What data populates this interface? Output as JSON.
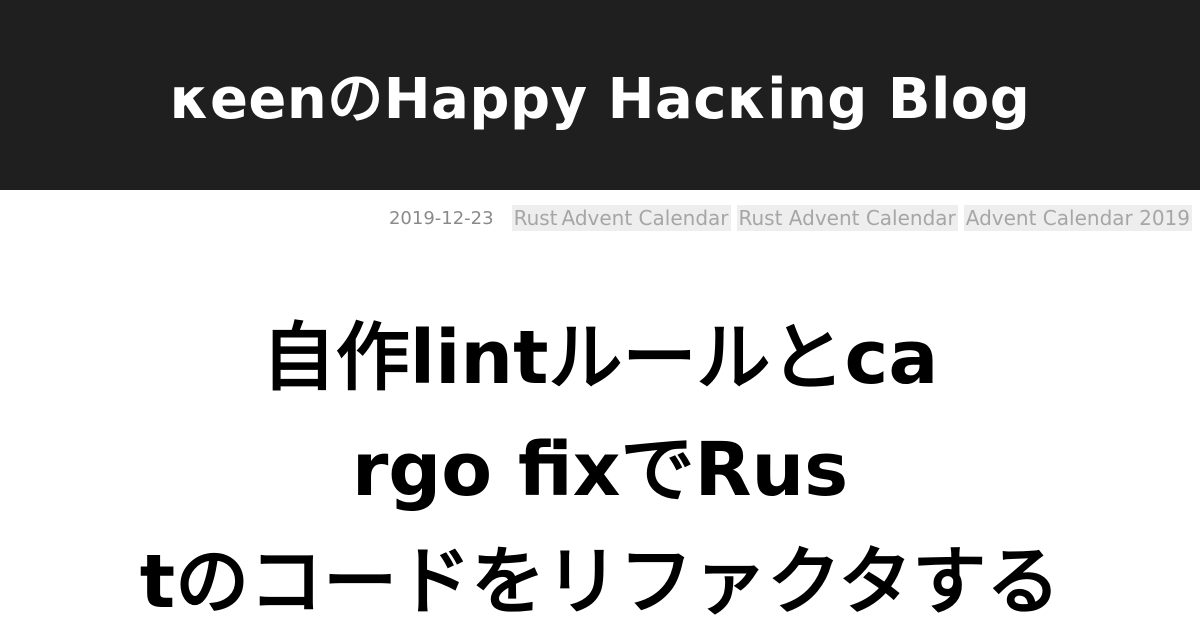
{
  "site": {
    "title": "κeenのHappy Hacκing Blog"
  },
  "post": {
    "date": "2019-12-23",
    "tags": [
      "Rust",
      "Advent Calendar",
      "Rust Advent Calendar",
      "Advent Calendar 2019"
    ],
    "title_lines": [
      "自作lintルールとca",
      "rgo fixでRus",
      "tのコードをリファクタする"
    ]
  },
  "colors": {
    "header_background": "#1f1f1f",
    "header_text": "#ffffff",
    "date_text": "#8a8a8a",
    "tag_background": "#eeeeee",
    "tag_text": "#a6a6a6",
    "title_text": "#000000"
  }
}
